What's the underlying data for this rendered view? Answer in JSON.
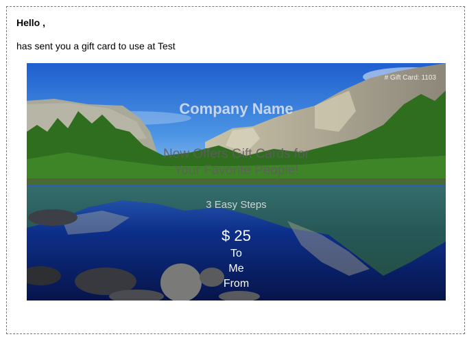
{
  "email": {
    "greeting": "Hello ,",
    "message": "has sent you a gift card to use at Test"
  },
  "gift_card": {
    "card_number": "# Gift Card: 1103",
    "company": "Company Name",
    "tagline_line1": "Now Offers Gift Cards for",
    "tagline_line2": "Your Favorite People!",
    "steps": "3 Easy Steps",
    "amount": "$ 25",
    "to_label": "To",
    "me_label": "Me",
    "from_label": "From",
    "background_image": "mountain-lake-landscape"
  },
  "colors": {
    "frame_border": "#777777",
    "sky": "#3a7fd6",
    "lake": "#0f2f86",
    "forest": "#2f6d1f"
  }
}
